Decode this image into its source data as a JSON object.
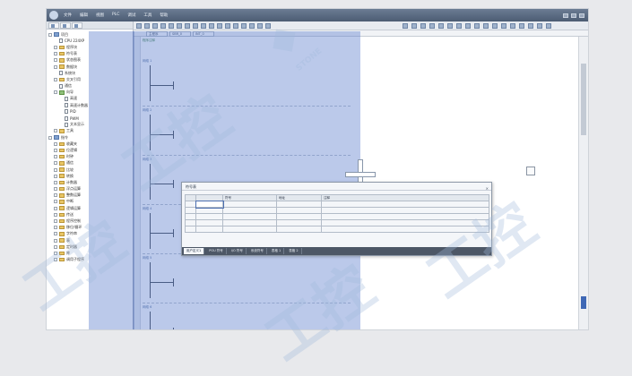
{
  "app": {
    "menu": [
      "文件",
      "编辑",
      "视图",
      "PLC",
      "调试",
      "工具",
      "帮助"
    ]
  },
  "left_panel": {
    "tree": [
      {
        "label": "项目",
        "indent": 0,
        "icon": "folder-blue"
      },
      {
        "label": "CPU 224XP",
        "indent": 1,
        "icon": "doc"
      },
      {
        "label": "程序块",
        "indent": 1,
        "icon": "folder"
      },
      {
        "label": "符号表",
        "indent": 1,
        "icon": "folder"
      },
      {
        "label": "状态图表",
        "indent": 1,
        "icon": "folder"
      },
      {
        "label": "数据块",
        "indent": 1,
        "icon": "folder"
      },
      {
        "label": "系统块",
        "indent": 1,
        "icon": "doc"
      },
      {
        "label": "交叉引用",
        "indent": 1,
        "icon": "folder"
      },
      {
        "label": "通信",
        "indent": 1,
        "icon": "doc"
      },
      {
        "label": "向导",
        "indent": 1,
        "icon": "folder-green"
      },
      {
        "label": "高速",
        "indent": 2,
        "icon": "doc"
      },
      {
        "label": "高速计数器",
        "indent": 2,
        "icon": "doc"
      },
      {
        "label": "PID",
        "indent": 2,
        "icon": "doc"
      },
      {
        "label": "PWM",
        "indent": 2,
        "icon": "doc"
      },
      {
        "label": "文本显示",
        "indent": 2,
        "icon": "doc"
      },
      {
        "label": "工具",
        "indent": 1,
        "icon": "folder"
      },
      {
        "label": "指令",
        "indent": 0,
        "icon": "folder-blue"
      },
      {
        "label": "收藏夹",
        "indent": 1,
        "icon": "folder"
      },
      {
        "label": "位逻辑",
        "indent": 1,
        "icon": "folder"
      },
      {
        "label": "时钟",
        "indent": 1,
        "icon": "folder"
      },
      {
        "label": "通信",
        "indent": 1,
        "icon": "folder"
      },
      {
        "label": "比较",
        "indent": 1,
        "icon": "folder"
      },
      {
        "label": "转换",
        "indent": 1,
        "icon": "folder"
      },
      {
        "label": "计数器",
        "indent": 1,
        "icon": "folder"
      },
      {
        "label": "浮点运算",
        "indent": 1,
        "icon": "folder"
      },
      {
        "label": "整数运算",
        "indent": 1,
        "icon": "folder"
      },
      {
        "label": "中断",
        "indent": 1,
        "icon": "folder"
      },
      {
        "label": "逻辑运算",
        "indent": 1,
        "icon": "folder"
      },
      {
        "label": "传送",
        "indent": 1,
        "icon": "folder"
      },
      {
        "label": "程序控制",
        "indent": 1,
        "icon": "folder"
      },
      {
        "label": "移位/循环",
        "indent": 1,
        "icon": "folder"
      },
      {
        "label": "字符串",
        "indent": 1,
        "icon": "folder"
      },
      {
        "label": "表",
        "indent": 1,
        "icon": "folder"
      },
      {
        "label": "定时器",
        "indent": 1,
        "icon": "folder"
      },
      {
        "label": "库",
        "indent": 1,
        "icon": "folder"
      },
      {
        "label": "调用子程序",
        "indent": 1,
        "icon": "folder"
      }
    ]
  },
  "editor": {
    "tabs": [
      "主程序",
      "SBR_0",
      "INT_0"
    ],
    "header": "程序注释",
    "networks": [
      "网络 1",
      "网络 2",
      "网络 3",
      "网络 4",
      "网络 5",
      "网络 6"
    ]
  },
  "dialog": {
    "title": "符号表",
    "close": "×",
    "columns": [
      "",
      "",
      "符号",
      "地址",
      "注释"
    ],
    "rows": [
      [
        "",
        "",
        "",
        "",
        ""
      ],
      [
        "",
        "",
        "",
        "",
        ""
      ],
      [
        "",
        "",
        "",
        "",
        ""
      ],
      [
        "",
        "",
        "",
        "",
        ""
      ],
      [
        "",
        "",
        "",
        "",
        ""
      ]
    ],
    "tabs": [
      "用户定义1",
      "POU 符号",
      "I/O 符号",
      "系统符号",
      "表格 1",
      "表格 2"
    ]
  },
  "watermarks": {
    "brand": "STONE",
    "text": "工控"
  },
  "colors": {
    "selection": "#5c7ecc",
    "titlebar": "#4c5c73",
    "accent": "#3f68b5"
  }
}
